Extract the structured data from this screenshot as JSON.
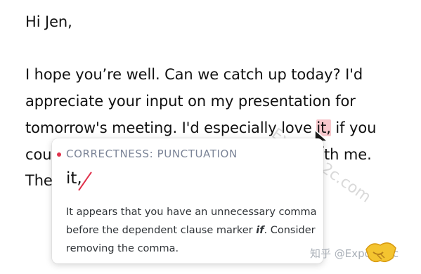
{
  "email": {
    "greeting": "Hi Jen,",
    "line1": "I hope you’re well. Can we catch up today? I'd",
    "line2": "appreciate your input on my presentation for",
    "line3_before": "tomorrow's meeting. I'd especially love ",
    "line3_flag": "it,",
    "line3_after": " if you",
    "line4_left": "cou",
    "line4_right": "th me.",
    "line5_left": "The"
  },
  "suggestion_card": {
    "category": "CORRECTNESS: PUNCTUATION",
    "suggestion_text": "it,",
    "description_part1": "It appears that you have an unnecessary comma before the dependent clause marker ",
    "description_keyword": "if",
    "description_part2": ". Consider removing the comma.",
    "accent_color": "#e0314b"
  },
  "watermark": {
    "bottom_text": "知乎 @Exportb2c",
    "diagonal_text": "Exportb2c.com"
  }
}
